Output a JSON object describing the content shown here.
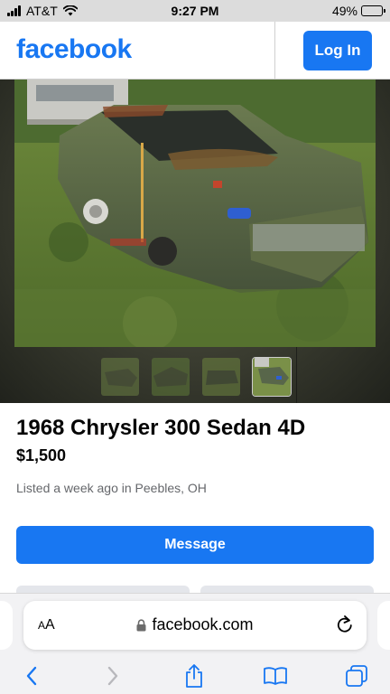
{
  "status_bar": {
    "carrier": "AT&T",
    "time": "9:27 PM",
    "battery": "49%",
    "battery_level": 0.49,
    "battery_color": "#f5c518"
  },
  "header": {
    "logo": "facebook",
    "login_label": "Log In",
    "brand_color": "#1877f2"
  },
  "gallery": {
    "main_photo": "car-photo",
    "thumbnails": [
      "thumbnail-1",
      "thumbnail-2",
      "thumbnail-3",
      "thumbnail-4"
    ],
    "active_thumbnail": 4
  },
  "listing": {
    "title": "1968 Chrysler 300 Sedan 4D",
    "price": "$1,500",
    "meta": "Listed a week ago in Peebles, OH",
    "message_label": "Message"
  },
  "browser": {
    "text_size_label": "AA",
    "url": "facebook.com",
    "icons": [
      "back-icon",
      "forward-icon",
      "share-icon",
      "bookmarks-icon",
      "tabs-icon",
      "reload-icon",
      "lock-icon"
    ]
  }
}
